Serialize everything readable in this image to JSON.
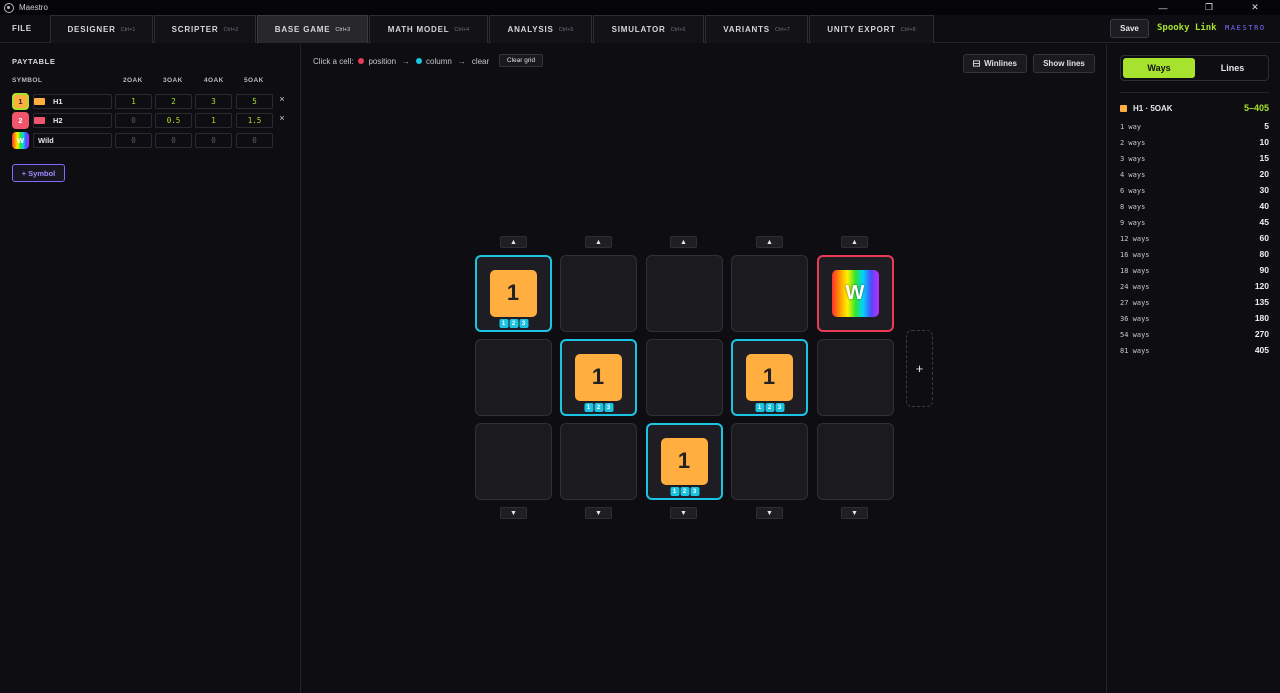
{
  "window": {
    "title": "Maestro",
    "min_glyph": "—",
    "max_glyph": "❐",
    "close_glyph": "✕"
  },
  "nav": {
    "file": "FILE",
    "tabs": [
      {
        "label": "DESIGNER",
        "shortcut": "Ctrl+1"
      },
      {
        "label": "SCRIPTER",
        "shortcut": "Ctrl+2"
      },
      {
        "label": "BASE GAME",
        "shortcut": "Ctrl+3",
        "active": true
      },
      {
        "label": "MATH MODEL",
        "shortcut": "Ctrl+4"
      },
      {
        "label": "ANALYSIS",
        "shortcut": "Ctrl+5"
      },
      {
        "label": "SIMULATOR",
        "shortcut": "Ctrl+6"
      },
      {
        "label": "VARIANTS",
        "shortcut": "Ctrl+7"
      },
      {
        "label": "UNITY EXPORT",
        "shortcut": "Ctrl+8"
      }
    ],
    "save": "Save",
    "project": "Spooky Link",
    "brand": "MAESTRO"
  },
  "paytable": {
    "title": "PAYTABLE",
    "headers": [
      "SYMBOL",
      "2OAK",
      "3OAK",
      "4OAK",
      "5OAK"
    ],
    "rows": [
      {
        "badge": "1",
        "name": "H1",
        "color": "#ffae3f",
        "values": [
          "1",
          "2",
          "3",
          "5"
        ],
        "delete": "×"
      },
      {
        "badge": "2",
        "name": "H2",
        "color": "#f0566b",
        "values": [
          "0",
          "0.5",
          "1",
          "1.5"
        ],
        "delete": "×"
      },
      {
        "badge": "W",
        "name": "Wild",
        "values": [
          "0",
          "0",
          "0",
          "0"
        ]
      }
    ],
    "add_symbol": "+ Symbol"
  },
  "toolbar": {
    "hint_prefix": "Click a cell:",
    "position": "position",
    "column": "column",
    "clear": "clear",
    "arrow": "→",
    "clear_grid": "Clear grid",
    "winlines": "Winlines",
    "show_lines": "Show lines",
    "position_color": "#e93b55",
    "column_color": "#1cc4e4"
  },
  "grid": {
    "up_arrow": "▲",
    "down_arrow": "▼",
    "add_reel": "+",
    "cells": [
      {
        "reel": 1,
        "row": 1,
        "symbol": "1",
        "mark": "column",
        "tags": [
          "1",
          "2",
          "3"
        ]
      },
      {
        "reel": 2,
        "row": 1
      },
      {
        "reel": 3,
        "row": 1
      },
      {
        "reel": 4,
        "row": 1
      },
      {
        "reel": 5,
        "row": 1,
        "symbol": "W",
        "wild": true,
        "mark": "position"
      },
      {
        "reel": 1,
        "row": 2
      },
      {
        "reel": 2,
        "row": 2,
        "symbol": "1",
        "mark": "column",
        "tags": [
          "1",
          "2",
          "3"
        ]
      },
      {
        "reel": 3,
        "row": 2
      },
      {
        "reel": 4,
        "row": 2,
        "symbol": "1",
        "mark": "column",
        "tags": [
          "1",
          "2",
          "3"
        ]
      },
      {
        "reel": 5,
        "row": 2
      },
      {
        "reel": 1,
        "row": 3
      },
      {
        "reel": 2,
        "row": 3
      },
      {
        "reel": 3,
        "row": 3,
        "symbol": "1",
        "mark": "column",
        "tags": [
          "1",
          "2",
          "3"
        ]
      },
      {
        "reel": 4,
        "row": 3
      },
      {
        "reel": 5,
        "row": 3
      }
    ]
  },
  "results": {
    "mode_ways": "Ways",
    "mode_lines": "Lines",
    "combo_label": "H1 · 5OAK",
    "combo_range": "5–405",
    "ways": [
      {
        "label": "1 way",
        "value": "5"
      },
      {
        "label": "2 ways",
        "value": "10"
      },
      {
        "label": "3 ways",
        "value": "15"
      },
      {
        "label": "4 ways",
        "value": "20"
      },
      {
        "label": "6 ways",
        "value": "30"
      },
      {
        "label": "8 ways",
        "value": "40"
      },
      {
        "label": "9 ways",
        "value": "45"
      },
      {
        "label": "12 ways",
        "value": "60"
      },
      {
        "label": "16 ways",
        "value": "80"
      },
      {
        "label": "18 ways",
        "value": "90"
      },
      {
        "label": "24 ways",
        "value": "120"
      },
      {
        "label": "27 ways",
        "value": "135"
      },
      {
        "label": "36 ways",
        "value": "180"
      },
      {
        "label": "54 ways",
        "value": "270"
      },
      {
        "label": "81 ways",
        "value": "405"
      }
    ]
  }
}
